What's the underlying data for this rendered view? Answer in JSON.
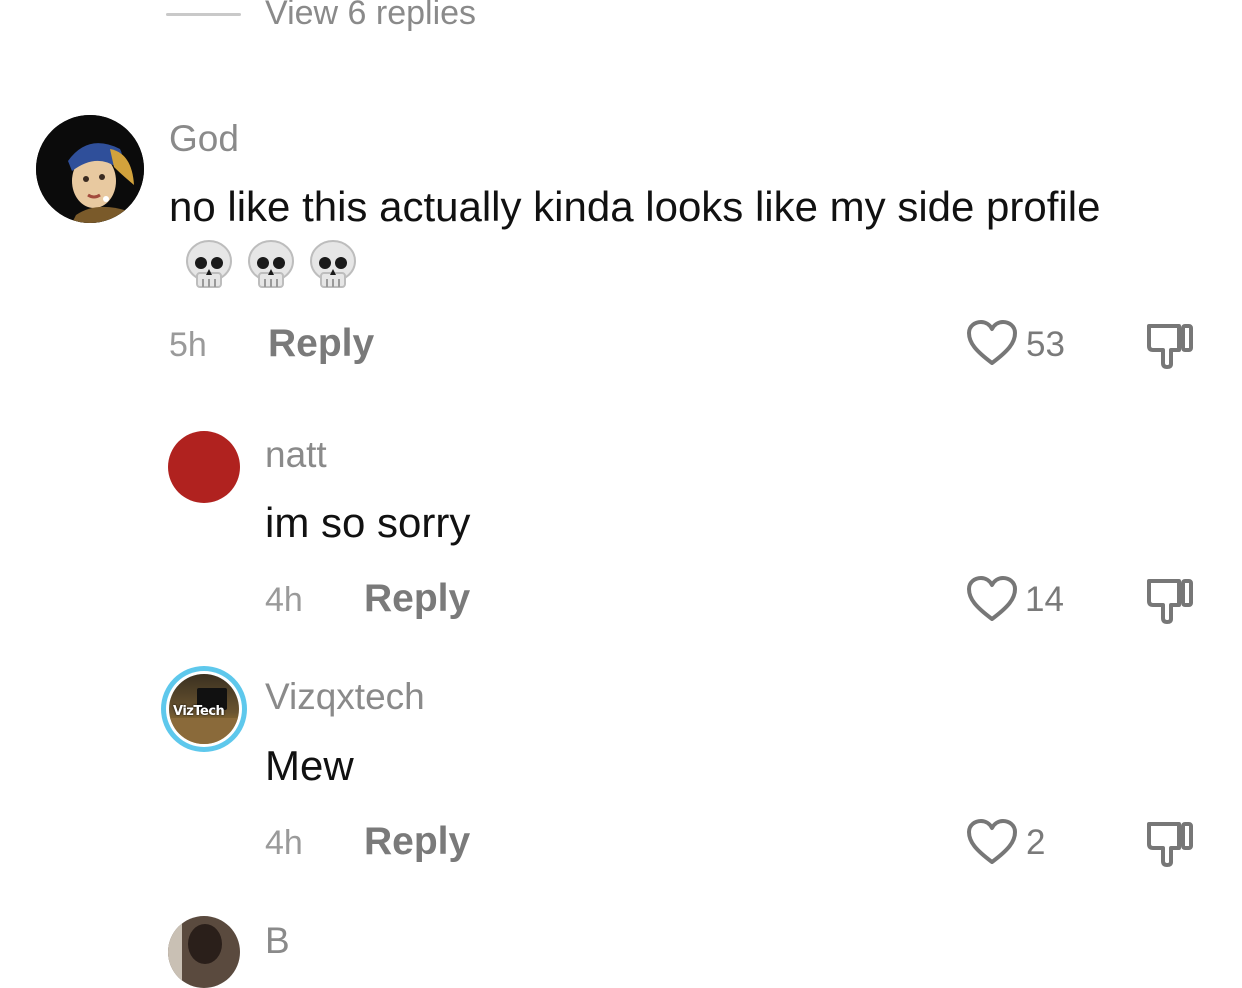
{
  "thread": {
    "view_replies": "View 6 replies"
  },
  "comments": [
    {
      "username": "God",
      "text": "no like this actually kinda looks like my side profile",
      "emoji": "💀💀💀",
      "time": "5h",
      "reply_label": "Reply",
      "likes": "53"
    },
    {
      "username": "natt",
      "text": "im so sorry",
      "time": "4h",
      "reply_label": "Reply",
      "likes": "14"
    },
    {
      "username": "Vizqxtech",
      "avatar_text": "VizTech",
      "text": "Mew",
      "time": "4h",
      "reply_label": "Reply",
      "likes": "2"
    },
    {
      "username": "B"
    }
  ],
  "icons": {
    "like": "heart-outline-icon",
    "dislike": "thumbs-down-outline-icon",
    "emoji": "skull-icon"
  },
  "colors": {
    "username_gray": "#8a8a8a",
    "meta_gray": "#9a9a9a",
    "natt_avatar": "#b0221f",
    "viz_ring": "#5ec8ec"
  }
}
